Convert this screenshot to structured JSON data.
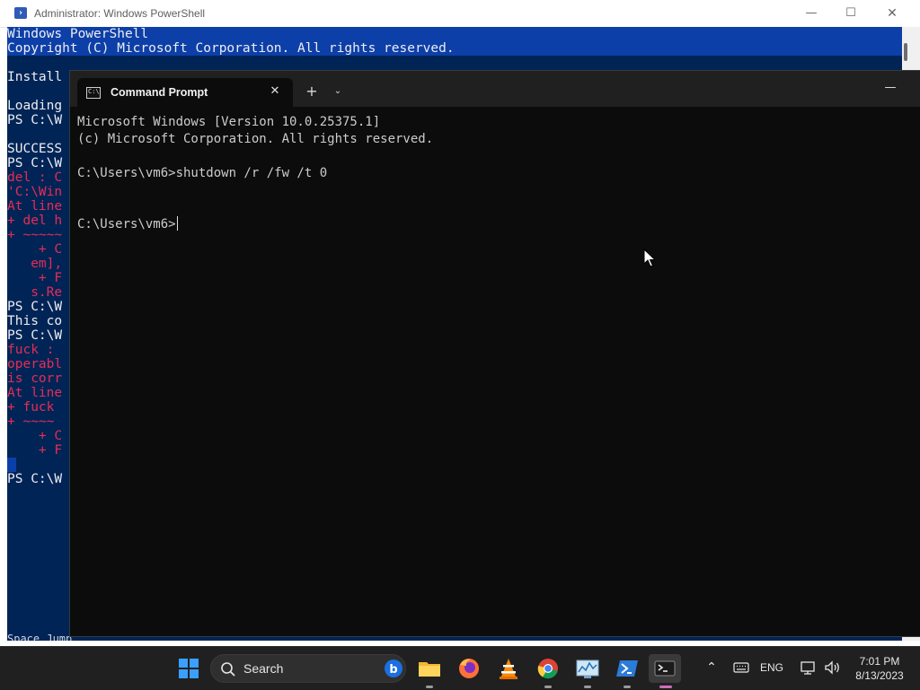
{
  "powershell": {
    "title": "Administrator: Windows PowerShell",
    "icon": "powershell-icon",
    "controls": {
      "minimize": "—",
      "maximize": "☐",
      "close": "✕"
    },
    "lines": [
      {
        "text": "Windows PowerShell",
        "color": "white"
      },
      {
        "text": "Copyright (C) Microsoft Corporation. All rights reserved.",
        "color": "white"
      },
      {
        "text": "",
        "color": "white"
      },
      {
        "text": "Install",
        "color": "white"
      },
      {
        "text": "",
        "color": "white"
      },
      {
        "text": "Loading",
        "color": "white"
      },
      {
        "text": "PS C:\\W",
        "color": "white"
      },
      {
        "text": "",
        "color": "white"
      },
      {
        "text": "SUCCESS",
        "color": "white"
      },
      {
        "text": "PS C:\\W",
        "color": "white"
      },
      {
        "text": "del : C",
        "color": "red"
      },
      {
        "text": "'C:\\Win",
        "color": "red"
      },
      {
        "text": "At line",
        "color": "red"
      },
      {
        "text": "+ del h",
        "color": "red"
      },
      {
        "text": "+ ~~~~~",
        "color": "red"
      },
      {
        "text": "    + C",
        "color": "red"
      },
      {
        "text": "   em],",
        "color": "red"
      },
      {
        "text": "    + F",
        "color": "red"
      },
      {
        "text": "   s.Re",
        "color": "red"
      },
      {
        "text": "PS C:\\W",
        "color": "white"
      },
      {
        "text": "This co",
        "color": "white"
      },
      {
        "text": "PS C:\\W",
        "color": "white"
      },
      {
        "text": "fuck : ",
        "color": "red"
      },
      {
        "text": "operabl",
        "color": "red"
      },
      {
        "text": "is corr",
        "color": "red"
      },
      {
        "text": "At line",
        "color": "red"
      },
      {
        "text": "+ fuck ",
        "color": "red"
      },
      {
        "text": "+ ~~~~",
        "color": "red"
      },
      {
        "text": "    + C",
        "color": "red"
      },
      {
        "text": "    + F",
        "color": "red"
      },
      {
        "text": "",
        "color": "white"
      },
      {
        "text": "PS C:\\W",
        "color": "white"
      }
    ],
    "bottom_clip": "Space Jump"
  },
  "terminal": {
    "tab_title": "Command Prompt",
    "tab_icon": "command-prompt-icon",
    "tab_icon_text": "C:\\",
    "close_tab": "✕",
    "new_tab": "+",
    "dropdown": "⌄",
    "minimize": "—",
    "lines": [
      "Microsoft Windows [Version 10.0.25375.1]",
      "(c) Microsoft Corporation. All rights reserved.",
      "",
      "C:\\Users\\vm6>shutdown /r /fw /t 0",
      "",
      "",
      "C:\\Users\\vm6>"
    ]
  },
  "taskbar": {
    "search_label": "Search",
    "apps": [
      {
        "name": "start-button",
        "icon": "windows-logo-icon"
      },
      {
        "name": "file-explorer",
        "icon": "folder-icon"
      },
      {
        "name": "firefox",
        "icon": "firefox-icon"
      },
      {
        "name": "vlc",
        "icon": "vlc-cone-icon"
      },
      {
        "name": "chrome",
        "icon": "chrome-icon"
      },
      {
        "name": "resource-monitor",
        "icon": "monitor-chart-icon"
      },
      {
        "name": "powershell",
        "icon": "powershell-icon"
      },
      {
        "name": "terminal",
        "icon": "terminal-icon"
      }
    ],
    "tray": {
      "language": "ENG",
      "time": "7:01 PM",
      "date": "8/13/2023"
    },
    "colors": {
      "background": "#202020",
      "active_indicator": "#d06cbc"
    }
  }
}
